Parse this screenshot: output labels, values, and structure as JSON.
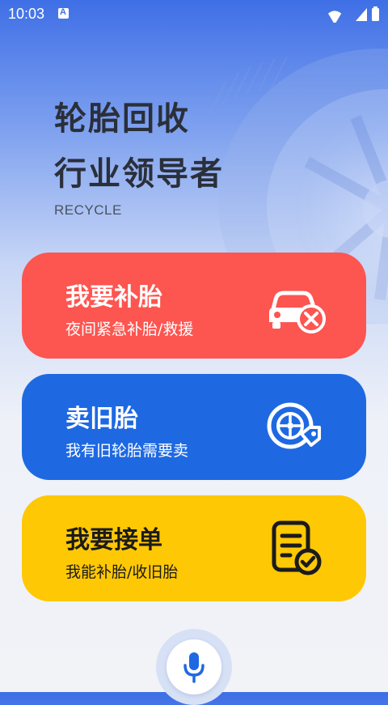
{
  "status_bar": {
    "time": "10:03"
  },
  "hero": {
    "line1": "轮胎回收",
    "line2": "行业领导者",
    "subtitle": "RECYCLE"
  },
  "cards": [
    {
      "title": "我要补胎",
      "desc": "夜间紧急补胎/救援",
      "icon": "car-repair-icon",
      "color": "#fd5550"
    },
    {
      "title": "卖旧胎",
      "desc": "我有旧轮胎需要卖",
      "icon": "tire-tag-icon",
      "color": "#1e69e2"
    },
    {
      "title": "我要接单",
      "desc": "我能补胎/收旧胎",
      "icon": "order-check-icon",
      "color": "#ffc804"
    }
  ],
  "mic": {
    "icon": "microphone-icon",
    "color": "#1e69e2"
  }
}
